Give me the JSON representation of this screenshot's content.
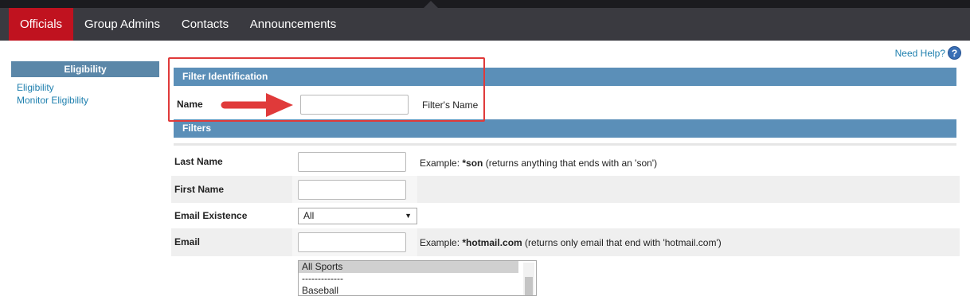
{
  "nav": {
    "tabs": [
      {
        "label": "Officials",
        "active": true
      },
      {
        "label": "Group Admins",
        "active": false
      },
      {
        "label": "Contacts",
        "active": false
      },
      {
        "label": "Announcements",
        "active": false
      }
    ]
  },
  "sidebar": {
    "header": "Eligibility",
    "links": [
      "Eligibility",
      "Monitor Eligibility"
    ]
  },
  "help": {
    "label": "Need Help?",
    "icon": "?"
  },
  "filter_identification": {
    "title": "Filter Identification",
    "name_label": "Name",
    "name_value": "",
    "name_hint": "Filter's Name"
  },
  "filters": {
    "title": "Filters",
    "last_name": {
      "label": "Last Name",
      "value": "",
      "hint_prefix": "Example: ",
      "hint_bold": "*son",
      "hint_suffix": " (returns anything that ends with an 'son')"
    },
    "first_name": {
      "label": "First Name",
      "value": ""
    },
    "email_existence": {
      "label": "Email Existence",
      "selected": "All"
    },
    "email": {
      "label": "Email",
      "value": "",
      "hint_prefix": "Example: ",
      "hint_bold": "*hotmail.com",
      "hint_suffix": " (returns only email that end with 'hotmail.com')"
    },
    "sports": {
      "options": [
        "All Sports",
        "-------------",
        "Baseball"
      ],
      "selected": "All Sports"
    }
  },
  "colors": {
    "nav_bg": "#3a3a40",
    "active_tab": "#c0121f",
    "section_bar": "#5b8fb8",
    "link": "#1e7fae",
    "highlight": "#e03a3a"
  }
}
